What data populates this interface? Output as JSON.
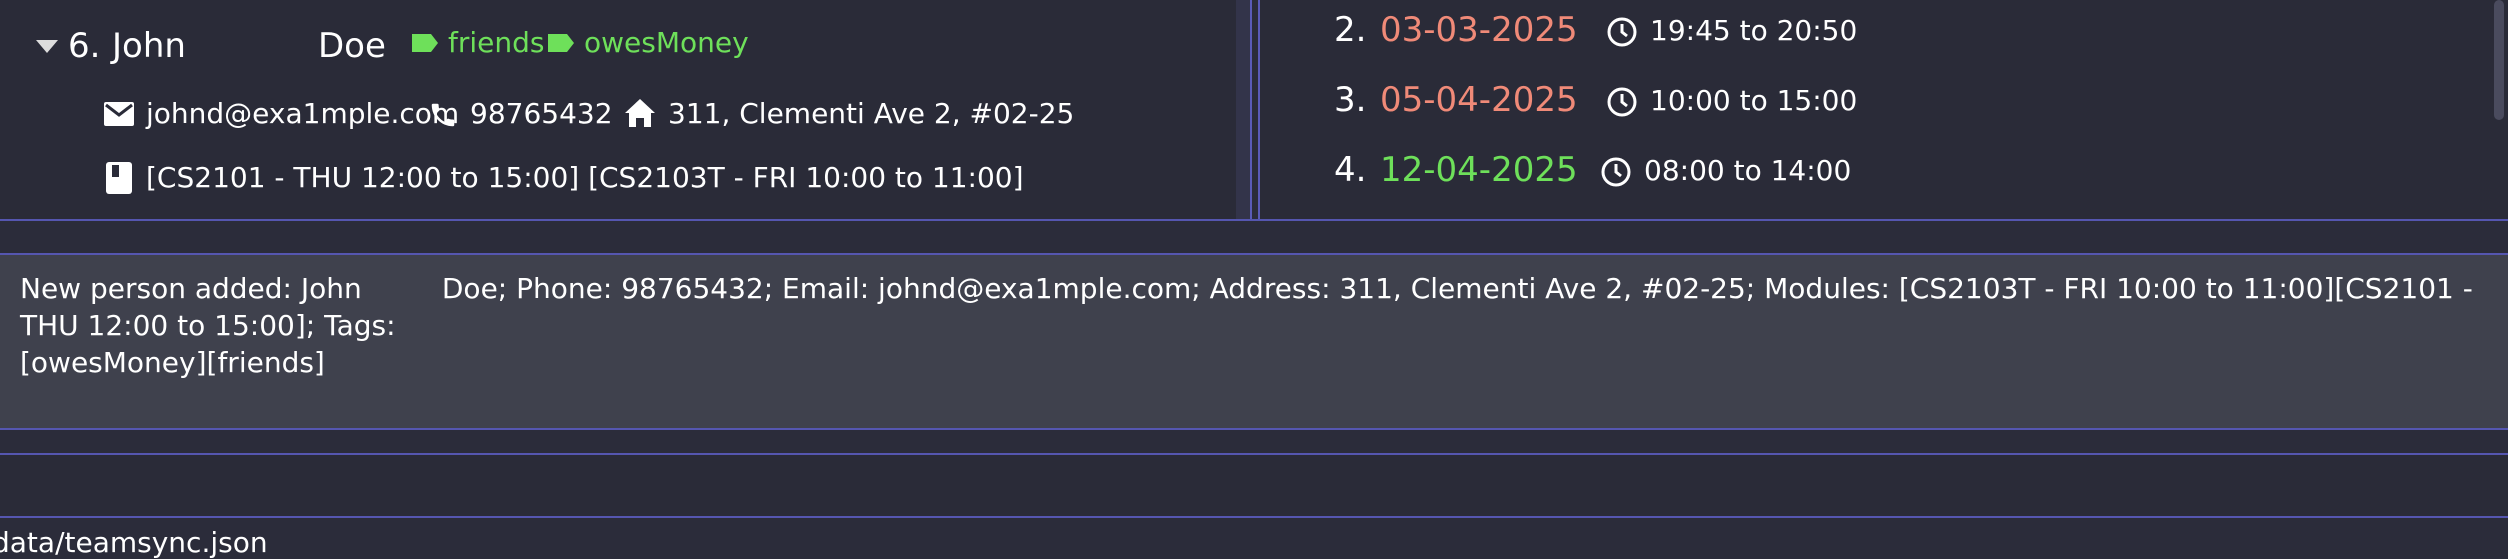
{
  "person_card": {
    "index": "6.",
    "first_name": "John",
    "last_name": "Doe",
    "tags": [
      "friends",
      "owesMoney"
    ],
    "email": "johnd@exa1mple.com",
    "phone": "98765432",
    "address": "311, Clementi Ave 2, #02-25",
    "modules": "[CS2101 - THU 12:00 to 15:00] [CS2103T - FRI 10:00 to 11:00]"
  },
  "appointments": [
    {
      "index": "2.",
      "date": "03-03-2025",
      "time": "19:45 to 20:50",
      "date_color": "#f08a78"
    },
    {
      "index": "3.",
      "date": "05-04-2025",
      "time": "10:00 to 15:00",
      "date_color": "#f08a78"
    },
    {
      "index": "4.",
      "date": "12-04-2025",
      "time": "08:00 to 14:00",
      "date_color": "#6ee05a"
    }
  ],
  "result": {
    "line1": "New person added: John         Doe; Phone: 98765432; Email: johnd@exa1mple.com; Address: 311, Clementi Ave 2, #02-25; Modules: [CS2103T - FRI 10:00 to 11:00][CS2101 - THU 12:00 to 15:00]; Tags:",
    "line2": "[owesMoney][friends]"
  },
  "command": {
    "value": ""
  },
  "status": {
    "file_path": "data/teamsync.json"
  },
  "colors": {
    "accent": "#5556b0",
    "tag_green": "#6ee05a",
    "date_overdue": "#f08a78",
    "date_upcoming": "#6ee05a"
  }
}
